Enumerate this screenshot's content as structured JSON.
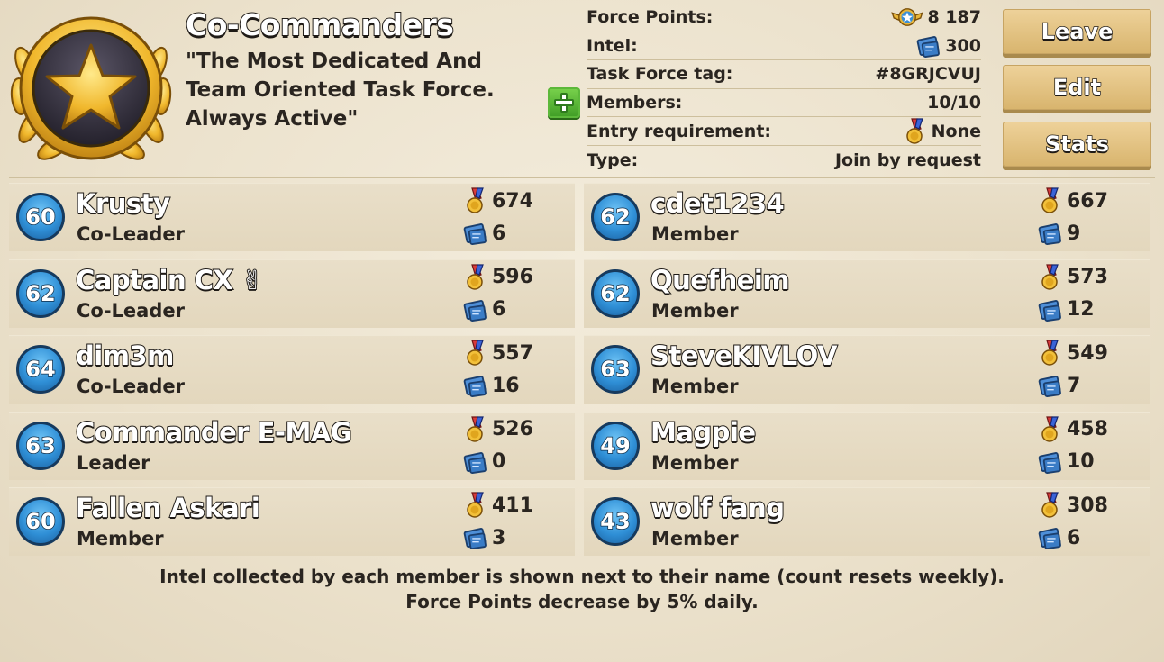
{
  "task_force": {
    "name": "Co-Commanders",
    "motto": "\"The Most Dedicated And Team Oriented Task Force. Always Active\""
  },
  "info": [
    {
      "label": "Force Points:",
      "value": "8 187",
      "icon": "force-points-icon"
    },
    {
      "label": "Intel:",
      "value": "300",
      "icon": "intel-icon"
    },
    {
      "label": "Task Force tag:",
      "value": "#8GRJCVUJ",
      "icon": ""
    },
    {
      "label": "Members:",
      "value": "10/10",
      "icon": ""
    },
    {
      "label": "Entry requirement:",
      "value": "None",
      "icon": "medal-icon"
    },
    {
      "label": "Type:",
      "value": "Join by request",
      "icon": ""
    }
  ],
  "buttons": {
    "leave": "Leave",
    "edit": "Edit",
    "stats": "Stats"
  },
  "members": [
    {
      "level": "60",
      "name": "Krusty",
      "role": "Co-Leader",
      "medals": "674",
      "intel": "6"
    },
    {
      "level": "62",
      "name": "cdet1234",
      "role": "Member",
      "medals": "667",
      "intel": "9"
    },
    {
      "level": "62",
      "name": "Captain CX ✌",
      "role": "Co-Leader",
      "medals": "596",
      "intel": "6"
    },
    {
      "level": "62",
      "name": "Quefheim",
      "role": "Member",
      "medals": "573",
      "intel": "12"
    },
    {
      "level": "64",
      "name": "dim3m",
      "role": "Co-Leader",
      "medals": "557",
      "intel": "16"
    },
    {
      "level": "63",
      "name": "SteveKIVLOV",
      "role": "Member",
      "medals": "549",
      "intel": "7"
    },
    {
      "level": "63",
      "name": "Commander E-MAG",
      "role": "Leader",
      "medals": "526",
      "intel": "0"
    },
    {
      "level": "49",
      "name": "Magpie",
      "role": "Member",
      "medals": "458",
      "intel": "10"
    },
    {
      "level": "60",
      "name": "Fallen Askari",
      "role": "Member",
      "medals": "411",
      "intel": "3"
    },
    {
      "level": "43",
      "name": "wolf fang",
      "role": "Member",
      "medals": "308",
      "intel": "6"
    }
  ],
  "footer": {
    "line1": "Intel collected by each member is shown next to their name (count resets weekly).",
    "line2": "Force Points decrease by 5% daily."
  }
}
